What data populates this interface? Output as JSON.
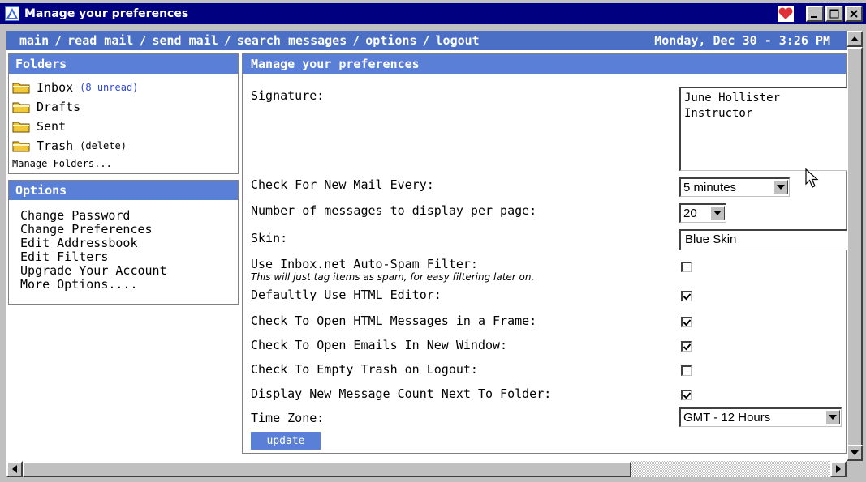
{
  "window": {
    "title": "Manage your preferences"
  },
  "nav": {
    "links": [
      "main",
      "read mail",
      "send mail",
      "search messages",
      "options",
      "logout"
    ],
    "separator": "/",
    "datetime": "Monday, Dec 30 - 3:26 PM"
  },
  "folders": {
    "title": "Folders",
    "items": [
      {
        "name": "Inbox",
        "note": "(8 unread)"
      },
      {
        "name": "Drafts"
      },
      {
        "name": "Sent"
      },
      {
        "name": "Trash",
        "note": "(delete)"
      }
    ],
    "manage_label": "Manage Folders..."
  },
  "options": {
    "title": "Options",
    "links": [
      "Change Password",
      "Change Preferences",
      "Edit Addressbook",
      "Edit Filters",
      "Upgrade Your Account",
      "More Options...."
    ]
  },
  "prefs": {
    "title": "Manage your preferences",
    "signature": {
      "label": "Signature:",
      "value": "June Hollister\nInstructor"
    },
    "check_mail": {
      "label": "Check For New Mail Every:",
      "value": "5 minutes"
    },
    "per_page": {
      "label": "Number of messages to display per page:",
      "value": "20"
    },
    "skin": {
      "label": "Skin:",
      "value": "Blue Skin"
    },
    "spam": {
      "label": "Use Inbox.net Auto-Spam Filter:",
      "sublabel": "This will just tag items as spam, for easy filtering later on.",
      "checked": false
    },
    "html_editor": {
      "label": "Defaultly Use HTML Editor:",
      "checked": true
    },
    "html_frame": {
      "label": "Check To Open HTML Messages in a Frame:",
      "checked": true
    },
    "new_window": {
      "label": "Check To Open Emails In New Window:",
      "checked": true
    },
    "empty_trash": {
      "label": "Check To Empty Trash on Logout:",
      "checked": false
    },
    "msg_count": {
      "label": "Display New Message Count Next To Folder:",
      "checked": true
    },
    "timezone": {
      "label": "Time Zone:",
      "value": "GMT - 12 Hours"
    },
    "update_label": "update"
  },
  "colors": {
    "nav_bg": "#4a6fc4",
    "header_bg": "#5a7fd6",
    "link_blue": "#2d47d9",
    "titlebar": "#000080"
  }
}
